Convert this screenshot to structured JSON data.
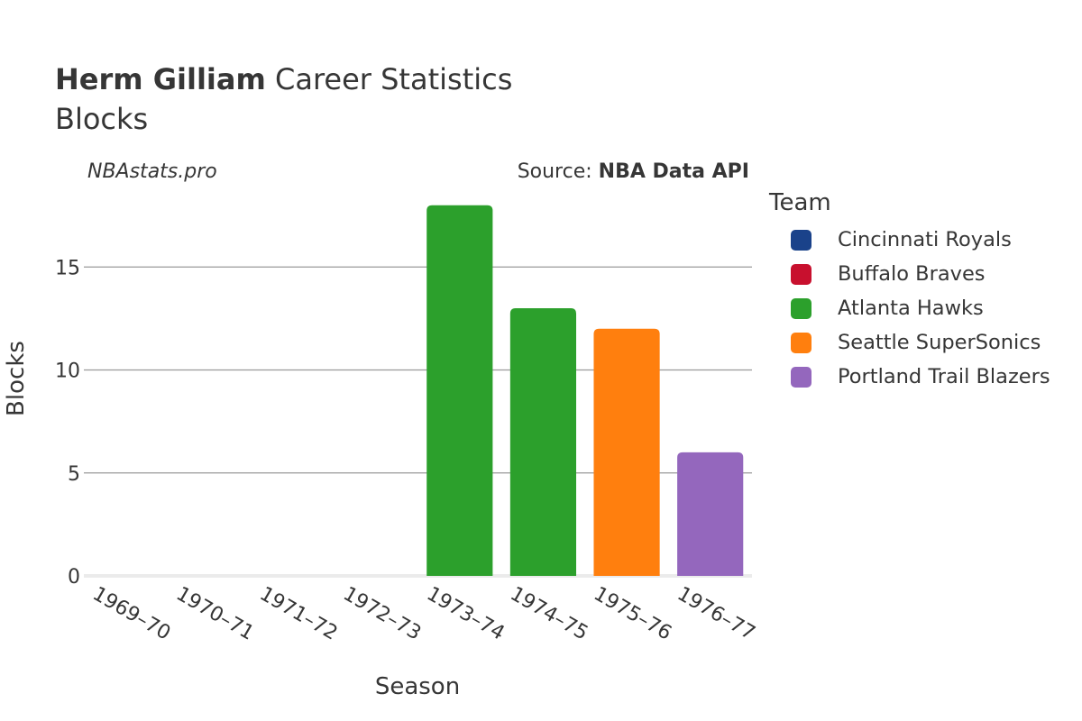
{
  "header": {
    "player_name": "Herm Gilliam",
    "title_rest": " Career Statistics",
    "subtitle": "Blocks",
    "brand": "NBAstats.pro",
    "source_prefix": "Source: ",
    "source_name": "NBA Data API"
  },
  "legend": {
    "title": "Team",
    "items": [
      {
        "label": "Cincinnati Royals",
        "color": "#1a428a"
      },
      {
        "label": "Buffalo Braves",
        "color": "#c8102e"
      },
      {
        "label": "Atlanta Hawks",
        "color": "#2ca02c"
      },
      {
        "label": "Seattle SuperSonics",
        "color": "#ff7f0e"
      },
      {
        "label": "Portland Trail Blazers",
        "color": "#9467bd"
      }
    ]
  },
  "chart_data": {
    "type": "bar",
    "title": "Herm Gilliam Career Statistics",
    "subtitle": "Blocks",
    "xlabel": "Season",
    "ylabel": "Blocks",
    "ylim": [
      0,
      19.3
    ],
    "yticks": [
      0,
      5,
      10,
      15
    ],
    "grid": true,
    "legend_position": "right",
    "categories": [
      "1969–70",
      "1970–71",
      "1971–72",
      "1972–73",
      "1973–74",
      "1974–75",
      "1975–76",
      "1976–77"
    ],
    "series": [
      {
        "name": "Cincinnati Royals",
        "color": "#1a428a",
        "values": [
          null,
          null,
          null,
          null,
          null,
          null,
          null,
          null
        ]
      },
      {
        "name": "Buffalo Braves",
        "color": "#c8102e",
        "values": [
          null,
          null,
          null,
          null,
          null,
          null,
          null,
          null
        ]
      },
      {
        "name": "Atlanta Hawks",
        "color": "#2ca02c",
        "values": [
          null,
          null,
          null,
          null,
          18,
          13,
          null,
          null
        ]
      },
      {
        "name": "Seattle SuperSonics",
        "color": "#ff7f0e",
        "values": [
          null,
          null,
          null,
          null,
          null,
          null,
          12,
          null
        ]
      },
      {
        "name": "Portland Trail Blazers",
        "color": "#9467bd",
        "values": [
          null,
          null,
          null,
          null,
          null,
          null,
          null,
          6
        ]
      }
    ]
  }
}
